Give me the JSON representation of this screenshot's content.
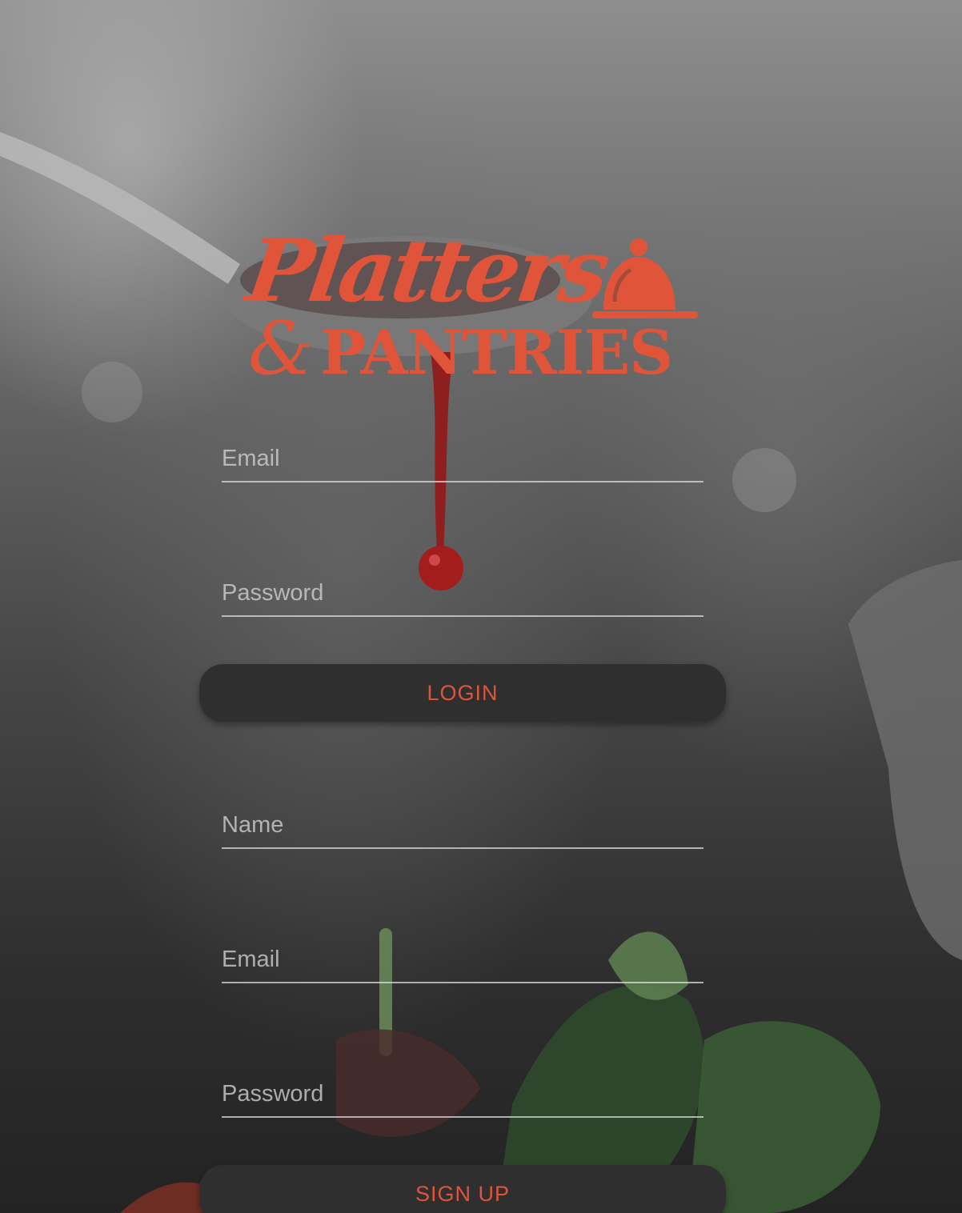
{
  "brand": {
    "script_text": "Platters",
    "amp_text": "&",
    "block_text": "PANTRIES",
    "accent_color": "#e0553a",
    "icon": "cloche-icon"
  },
  "login": {
    "email_placeholder": "Email",
    "password_placeholder": "Password",
    "button_label": "LOGIN"
  },
  "signup": {
    "name_placeholder": "Name",
    "email_placeholder": "Email",
    "password_placeholder": "Password",
    "button_label": "SIGN UP"
  },
  "colors": {
    "button_bg": "#2f2f2f",
    "button_text": "#e0553a",
    "placeholder": "#d2d2d2"
  }
}
